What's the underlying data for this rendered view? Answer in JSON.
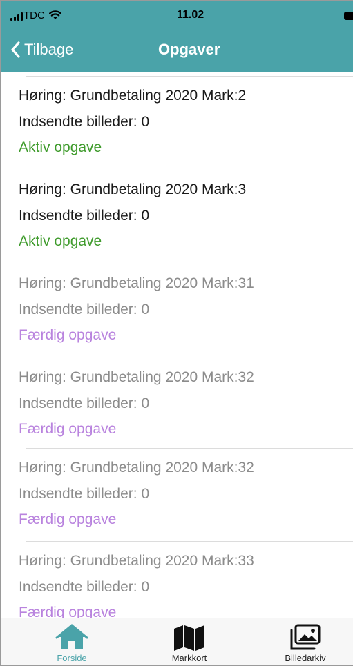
{
  "status_bar": {
    "carrier": "TDC",
    "time": "11.02"
  },
  "nav": {
    "back_label": "Tilbage",
    "title": "Opgaver"
  },
  "tasks": [
    {
      "title": "Høring: Grundbetaling 2020 Mark:2",
      "images": "Indsendte billeder: 0",
      "status": "Aktiv opgave",
      "state": "active"
    },
    {
      "title": "Høring: Grundbetaling 2020 Mark:3",
      "images": "Indsendte billeder: 0",
      "status": "Aktiv opgave",
      "state": "active"
    },
    {
      "title": "Høring: Grundbetaling 2020 Mark:31",
      "images": "Indsendte billeder: 0",
      "status": "Færdig opgave",
      "state": "done"
    },
    {
      "title": "Høring: Grundbetaling 2020 Mark:32",
      "images": "Indsendte billeder: 0",
      "status": "Færdig opgave",
      "state": "done"
    },
    {
      "title": "Høring: Grundbetaling 2020 Mark:32",
      "images": "Indsendte billeder: 0",
      "status": "Færdig opgave",
      "state": "done"
    },
    {
      "title": "Høring: Grundbetaling 2020 Mark:33",
      "images": "Indsendte billeder: 0",
      "status": "Færdig opgave",
      "state": "done"
    }
  ],
  "tabbar": {
    "home": {
      "label": "Forside",
      "icon": "home-icon"
    },
    "map": {
      "label": "Markkort",
      "icon": "map-icon"
    },
    "gallery": {
      "label": "Billedarkiv",
      "icon": "gallery-icon"
    }
  },
  "colors": {
    "header": "#4aa3a9",
    "active_status": "#3f9b2c",
    "done_status": "#b983de",
    "selected_tab": "#4aa3a9"
  }
}
